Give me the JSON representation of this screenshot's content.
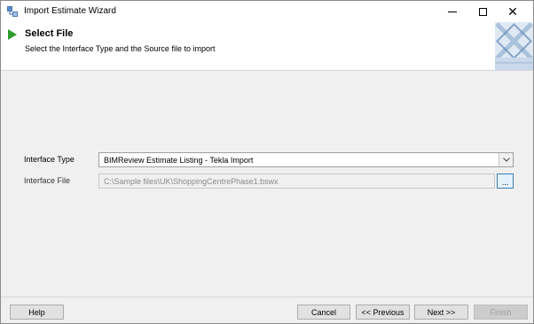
{
  "window": {
    "title": "Import Estimate Wizard"
  },
  "header": {
    "title": "Select File",
    "subtitle": "Select the Interface Type and the Source file to import"
  },
  "form": {
    "interface_type_label": "Interface Type",
    "interface_type_value": "BIMReview Estimate Listing - Tekla Import",
    "interface_file_label": "Interface File",
    "interface_file_value": "C:\\Sample files\\UK\\ShoppingCentrePhase1.bswx",
    "browse_label": "..."
  },
  "footer": {
    "help_label": "Help",
    "cancel_label": "Cancel",
    "previous_label": "<< Previous",
    "next_label": "Next >>",
    "finish_label": "Finish"
  },
  "colors": {
    "step_arrow": "#2e9c2e",
    "browse_border": "#3c7fb1",
    "disabled_text": "#a0a0a0"
  },
  "icons": {
    "app": "wizard-app-icon",
    "step": "green-play-arrow-icon",
    "dropdown": "chevron-down-icon"
  }
}
